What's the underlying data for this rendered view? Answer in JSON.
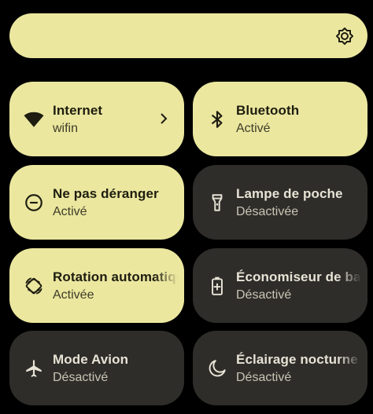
{
  "brightness": {
    "icon": "brightness-icon"
  },
  "tiles": [
    {
      "title": "Internet",
      "status": "wifin",
      "icon": "wifi-icon",
      "active": true
    },
    {
      "title": "Bluetooth",
      "status": "Activé",
      "icon": "bluetooth-icon",
      "active": true
    },
    {
      "title": "Ne pas déranger",
      "status": "Activé",
      "icon": "do-not-disturb-icon",
      "active": true
    },
    {
      "title": "Lampe de poche",
      "status": "Désactivée",
      "icon": "flashlight-icon",
      "active": false
    },
    {
      "title": "Rotation automatique",
      "status": "Activée",
      "icon": "auto-rotate-icon",
      "active": true
    },
    {
      "title": "Économiseur de batterie",
      "status": "Désactivé",
      "icon": "battery-saver-icon",
      "active": false
    },
    {
      "title": "Mode Avion",
      "status": "Désactivé",
      "icon": "airplane-icon",
      "active": false
    },
    {
      "title": "Éclairage nocturne",
      "status": "Désactivé",
      "icon": "night-light-icon",
      "active": false
    }
  ],
  "colors": {
    "active_tile": "#ebe79f",
    "inactive_tile": "#2e2d2a",
    "background": "#000000"
  }
}
